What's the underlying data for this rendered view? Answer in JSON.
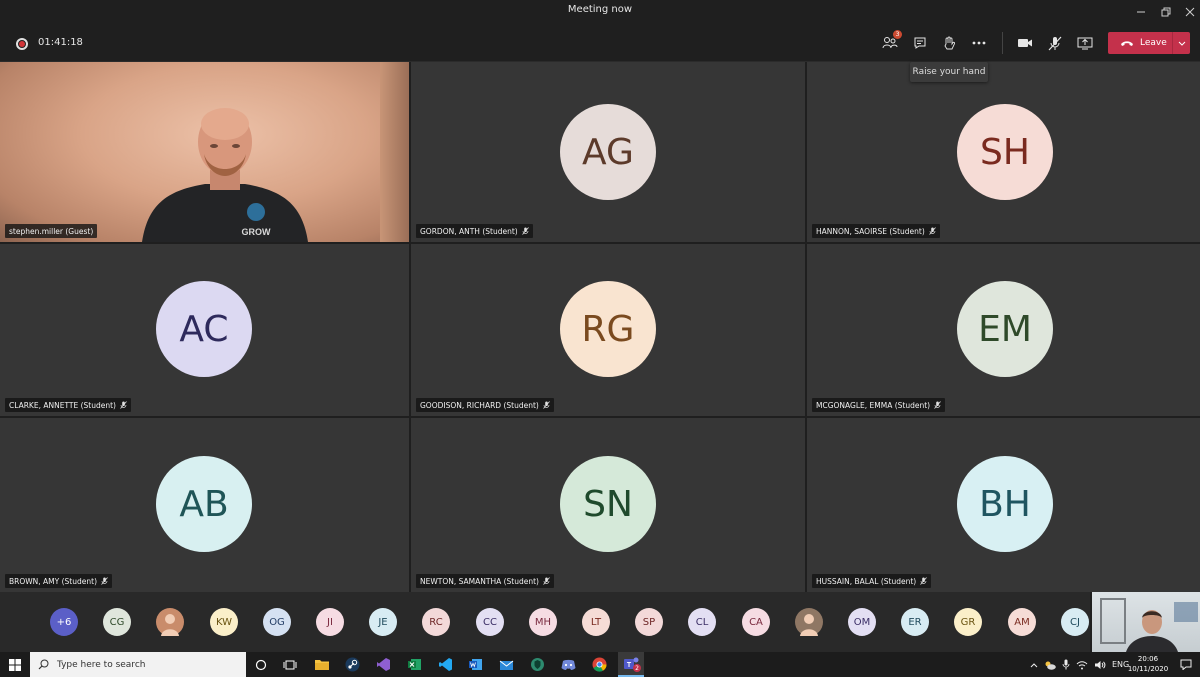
{
  "window": {
    "title": "Meeting now"
  },
  "meeting": {
    "timer": "01:41:18",
    "leave_label": "Leave",
    "participants_badge": "3",
    "tooltip": "Raise your hand"
  },
  "tiles": [
    {
      "name": "stephen.miller (Guest)",
      "initials": "",
      "video": true,
      "muted": false
    },
    {
      "name": "GORDON, ANTH (Student)",
      "initials": "AG",
      "bg": "#e6dcd9",
      "fg": "#5c3a2a",
      "muted": true
    },
    {
      "name": "HANNON, SAOIRSE (Student)",
      "initials": "SH",
      "bg": "#f6dcd6",
      "fg": "#7a2a1f",
      "muted": true
    },
    {
      "name": "CLARKE, ANNETTE (Student)",
      "initials": "AC",
      "bg": "#dcd9f2",
      "fg": "#2e2a5c",
      "muted": true
    },
    {
      "name": "GOODISON, RICHARD (Student)",
      "initials": "RG",
      "bg": "#f9e4d0",
      "fg": "#7a4a1f",
      "muted": true
    },
    {
      "name": "MCGONAGLE, EMMA (Student)",
      "initials": "EM",
      "bg": "#dfe6dc",
      "fg": "#2f4a2a",
      "muted": true
    },
    {
      "name": "BROWN, AMY (Student)",
      "initials": "AB",
      "bg": "#d8f0f1",
      "fg": "#1f5557",
      "muted": true
    },
    {
      "name": "NEWTON, SAMANTHA (Student)",
      "initials": "SN",
      "bg": "#d5e9d9",
      "fg": "#1f4a2c",
      "muted": true
    },
    {
      "name": "HUSSAIN, BALAL (Student)",
      "initials": "BH",
      "bg": "#d8f0f3",
      "fg": "#1f5560",
      "muted": true
    }
  ],
  "roster": [
    {
      "label": "+6",
      "bg": "#5b5fc7",
      "fg": "#ffffff"
    },
    {
      "label": "CG",
      "bg": "#dfe6dc",
      "fg": "#2f4a2a"
    },
    {
      "label": "",
      "photo": true,
      "bg": "#c98c6b",
      "fg": "#ffffff"
    },
    {
      "label": "KW",
      "bg": "#fbefc9",
      "fg": "#6a5412"
    },
    {
      "label": "OG",
      "bg": "#d5e1f2",
      "fg": "#243e66"
    },
    {
      "label": "JI",
      "bg": "#f6dce3",
      "fg": "#7a2a3f"
    },
    {
      "label": "JE",
      "bg": "#d8ecf3",
      "fg": "#1f4a5c"
    },
    {
      "label": "RC",
      "bg": "#f3d9d9",
      "fg": "#6e2727"
    },
    {
      "label": "CC",
      "bg": "#e3dff3",
      "fg": "#3b2e66"
    },
    {
      "label": "MH",
      "bg": "#f6dce3",
      "fg": "#7a2a3f"
    },
    {
      "label": "LT",
      "bg": "#f6dcd6",
      "fg": "#7a2a1f"
    },
    {
      "label": "SP",
      "bg": "#f3d9d9",
      "fg": "#6e2727"
    },
    {
      "label": "CL",
      "bg": "#e3dff3",
      "fg": "#3b2e66"
    },
    {
      "label": "CA",
      "bg": "#f6dce3",
      "fg": "#7a2a3f"
    },
    {
      "label": "",
      "photo": true,
      "bg": "#8f7764",
      "fg": "#ffffff"
    },
    {
      "label": "OM",
      "bg": "#e3dff3",
      "fg": "#3b2e66"
    },
    {
      "label": "ER",
      "bg": "#d8ecf3",
      "fg": "#1f4a5c"
    },
    {
      "label": "GR",
      "bg": "#fbefc9",
      "fg": "#6a5412"
    },
    {
      "label": "AM",
      "bg": "#f6dcd6",
      "fg": "#7a2a1f"
    },
    {
      "label": "CJ",
      "bg": "#d8ecf3",
      "fg": "#1f4a5c"
    }
  ],
  "taskbar": {
    "search_placeholder": "Type here to search",
    "language": "ENG",
    "time": "20:06",
    "date": "10/11/2020",
    "teams_badge": "2"
  }
}
